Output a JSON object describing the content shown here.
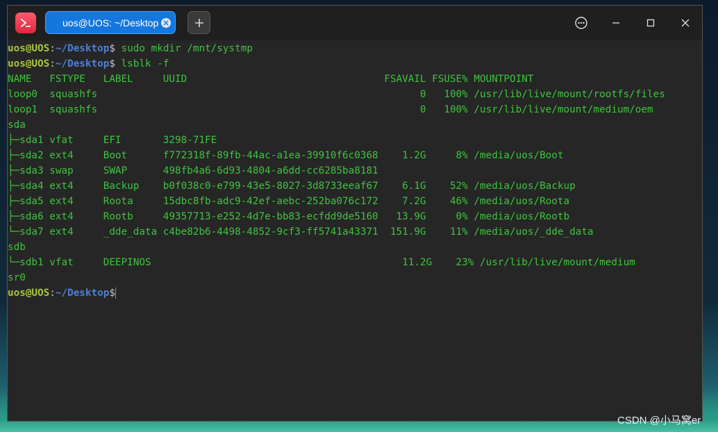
{
  "window": {
    "tab_title": "uos@UOS: ~/Desktop"
  },
  "terminal": {
    "prompt": {
      "user": "uos@UOS",
      "colon": ":",
      "path": "~/Desktop",
      "dollar": "$"
    },
    "commands": [
      " sudo mkdir /mnt/systmp",
      " lsblk -f",
      ""
    ],
    "output": [
      "NAME   FSTYPE   LABEL     UUID                                 FSAVAIL FSUSE% MOUNTPOINT",
      "loop0  squashfs                                                      0   100% /usr/lib/live/mount/rootfs/files",
      "loop1  squashfs                                                      0   100% /usr/lib/live/mount/medium/oem",
      "sda",
      "├─sda1 vfat     EFI       3298-71FE",
      "├─sda2 ext4     Boot      f772318f-89fb-44ac-a1ea-39910f6c0368    1.2G     8% /media/uos/Boot",
      "├─sda3 swap     SWAP      498fb4a6-6d93-4804-a6dd-cc6285ba8181",
      "├─sda4 ext4     Backup    b0f038c0-e799-43e5-8027-3d8733eeaf67    6.1G    52% /media/uos/Backup",
      "├─sda5 ext4     Roota     15dbc8fb-adc9-42ef-aebc-252ba076c172    7.2G    46% /media/uos/Roota",
      "├─sda6 ext4     Rootb     49357713-e252-4d7e-bb83-ecfdd9de5160   13.9G     0% /media/uos/Rootb",
      "└─sda7 ext4     _dde_data c4be82b6-4498-4852-9cf3-ff5741a43371  151.9G    11% /media/uos/_dde_data",
      "sdb",
      "└─sdb1 vfat     DEEPINOS                                          11.2G    23% /usr/lib/live/mount/medium",
      "sr0"
    ]
  },
  "watermark": "CSDN @小马窝er",
  "colors": {
    "accent": "#1577dd",
    "terminal_text": "#3fc33f",
    "prompt_user": "#a8c73c",
    "prompt_path": "#4f7fd8"
  },
  "icons": {
    "app": "terminal-icon",
    "tab_close": "close-icon",
    "new_tab": "plus-icon",
    "menu": "more-icon",
    "minimize": "minimize-icon",
    "maximize": "maximize-icon",
    "close": "close-icon"
  }
}
